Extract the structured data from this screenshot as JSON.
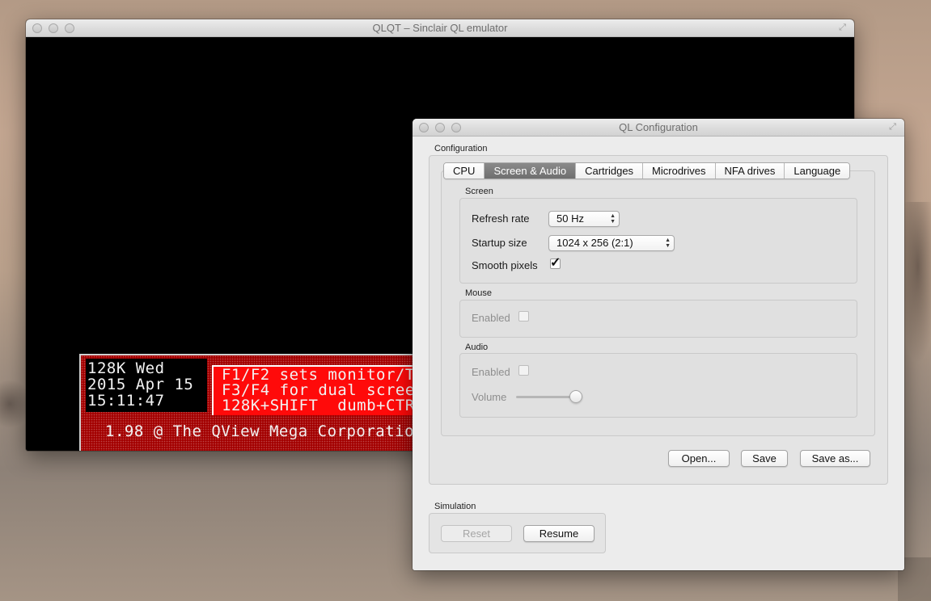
{
  "main_window": {
    "title": "QLQT – Sinclair QL emulator",
    "screen": {
      "status_lines": [
        "128K Wed",
        "2015 Apr 15",
        "15:11:47"
      ],
      "info_lines": [
        "F1/F2 sets monitor/T",
        "F3/F4 for dual scree",
        "128K+SHIFT  dumb+CTR"
      ],
      "copyright_line": "1.98 @ The QView Mega Corporatio"
    }
  },
  "config_window": {
    "title": "QL Configuration",
    "configuration_group": "Configuration",
    "tabs": [
      {
        "label": "CPU",
        "active": false
      },
      {
        "label": "Screen & Audio",
        "active": true
      },
      {
        "label": "Cartridges",
        "active": false
      },
      {
        "label": "Microdrives",
        "active": false
      },
      {
        "label": "NFA drives",
        "active": false
      },
      {
        "label": "Language",
        "active": false
      }
    ],
    "screen_group": {
      "label": "Screen",
      "refresh_rate_label": "Refresh rate",
      "refresh_rate_value": "50 Hz",
      "startup_size_label": "Startup size",
      "startup_size_value": "1024 x 256 (2:1)",
      "smooth_pixels_label": "Smooth pixels",
      "smooth_pixels_checked": true
    },
    "mouse_group": {
      "label": "Mouse",
      "enabled_label": "Enabled",
      "enabled_checked": false
    },
    "audio_group": {
      "label": "Audio",
      "enabled_label": "Enabled",
      "enabled_checked": false,
      "volume_label": "Volume",
      "volume_fraction": 0.9
    },
    "buttons": {
      "open": "Open...",
      "save": "Save",
      "save_as": "Save as..."
    },
    "simulation_group": {
      "label": "Simulation",
      "reset": "Reset",
      "resume": "Resume"
    }
  },
  "colors": {
    "ql_red": "#ff0a0a",
    "ql_dark_red": "#a30000",
    "active_tab": "#7a7a7a"
  }
}
